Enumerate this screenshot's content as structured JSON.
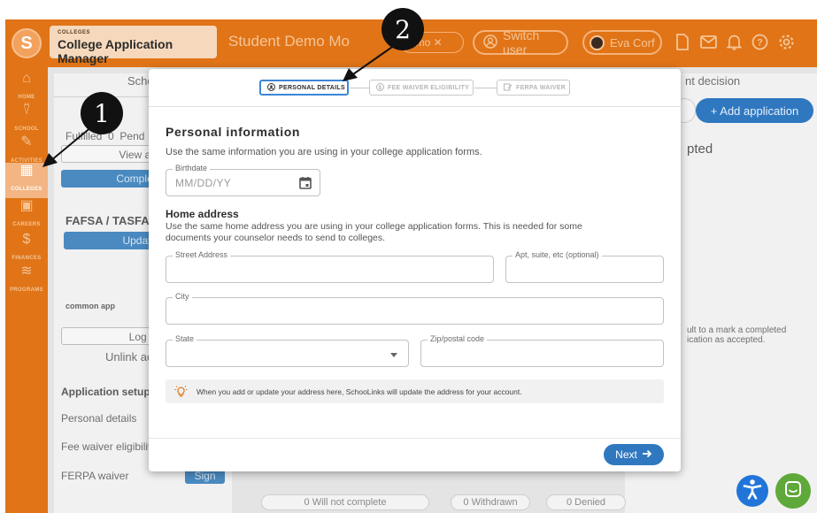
{
  "header": {
    "app_small": "COLLEGES",
    "app_name": "College Application Manager",
    "demo_title": "Student Demo Mo",
    "demo_chip": "emo ✕",
    "switch_user": "Switch user",
    "user_name": "Eva Corf",
    "icons": [
      "document-icon",
      "mail-icon",
      "bell-icon",
      "help-icon",
      "settings-icon"
    ]
  },
  "nav": {
    "items": [
      {
        "label": "HOME",
        "icon": "home-icon"
      },
      {
        "label": "SCHOOL",
        "icon": "school-icon"
      },
      {
        "label": "ACTIVITIES",
        "icon": "activities-icon"
      },
      {
        "label": "COLLEGES",
        "icon": "colleges-icon",
        "active": true
      },
      {
        "label": "CAREERS",
        "icon": "careers-icon"
      },
      {
        "label": "FINANCES",
        "icon": "finances-icon"
      },
      {
        "label": "PROGRAMS",
        "icon": "programs-icon"
      }
    ]
  },
  "background": {
    "schools_tab": "Scho",
    "fulfilled": "Fulfilled",
    "fulfilled_count": "0",
    "pending": "Pend",
    "view_all": "View all re",
    "complete": "Complete b",
    "fafsa": "FAFSA / TASFA",
    "update": "Update S",
    "commonapp_logo": "common app",
    "login": "Log in",
    "unlink": "Unlink ac",
    "setup_title": "Application setup",
    "setup_items": [
      "Personal details",
      "Fee waiver eligibility",
      "FERPA waiver"
    ],
    "sign_label": "Sign",
    "decision_tab": "nt decision",
    "add_application": "+ Add application",
    "accepted": "pted",
    "mark_hint_1": "ult to a mark a completed",
    "mark_hint_2": "ication as accepted.",
    "will_not_complete": "0  Will not complete",
    "withdrawn": "0  Withdrawn",
    "denied": "0  Denied"
  },
  "modal": {
    "steps": [
      {
        "label": "PERSONAL DETAILS",
        "icon": "person-icon",
        "active": true
      },
      {
        "label": "FEE WAIVER ELIGIBILITY",
        "icon": "dollar-icon",
        "active": false
      },
      {
        "label": "FERPA WAIVER",
        "icon": "sign-icon",
        "active": false
      }
    ],
    "title": "Personal information",
    "subtitle": "Use the same information you are using in your college application forms.",
    "birthdate": {
      "label": "Birthdate",
      "placeholder": "MM/DD/YY"
    },
    "address_title": "Home address",
    "address_desc": "Use the same home address you are using in your college application forms. This is needed for some documents your counselor needs to send to colleges.",
    "fields": {
      "street": "Street Address",
      "apt": "Apt, suite, etc (optional)",
      "city": "City",
      "state": "State",
      "zip": "Zip/postal code"
    },
    "notice": "When you add or update your address here, SchooLinks will update the address for your account.",
    "next": "Next"
  },
  "callouts": {
    "one": "1",
    "two": "2"
  },
  "colors": {
    "brand": "#e07417",
    "primary": "#2f78c0",
    "chat": "#5fa83a",
    "accessibility": "#2275d8"
  }
}
